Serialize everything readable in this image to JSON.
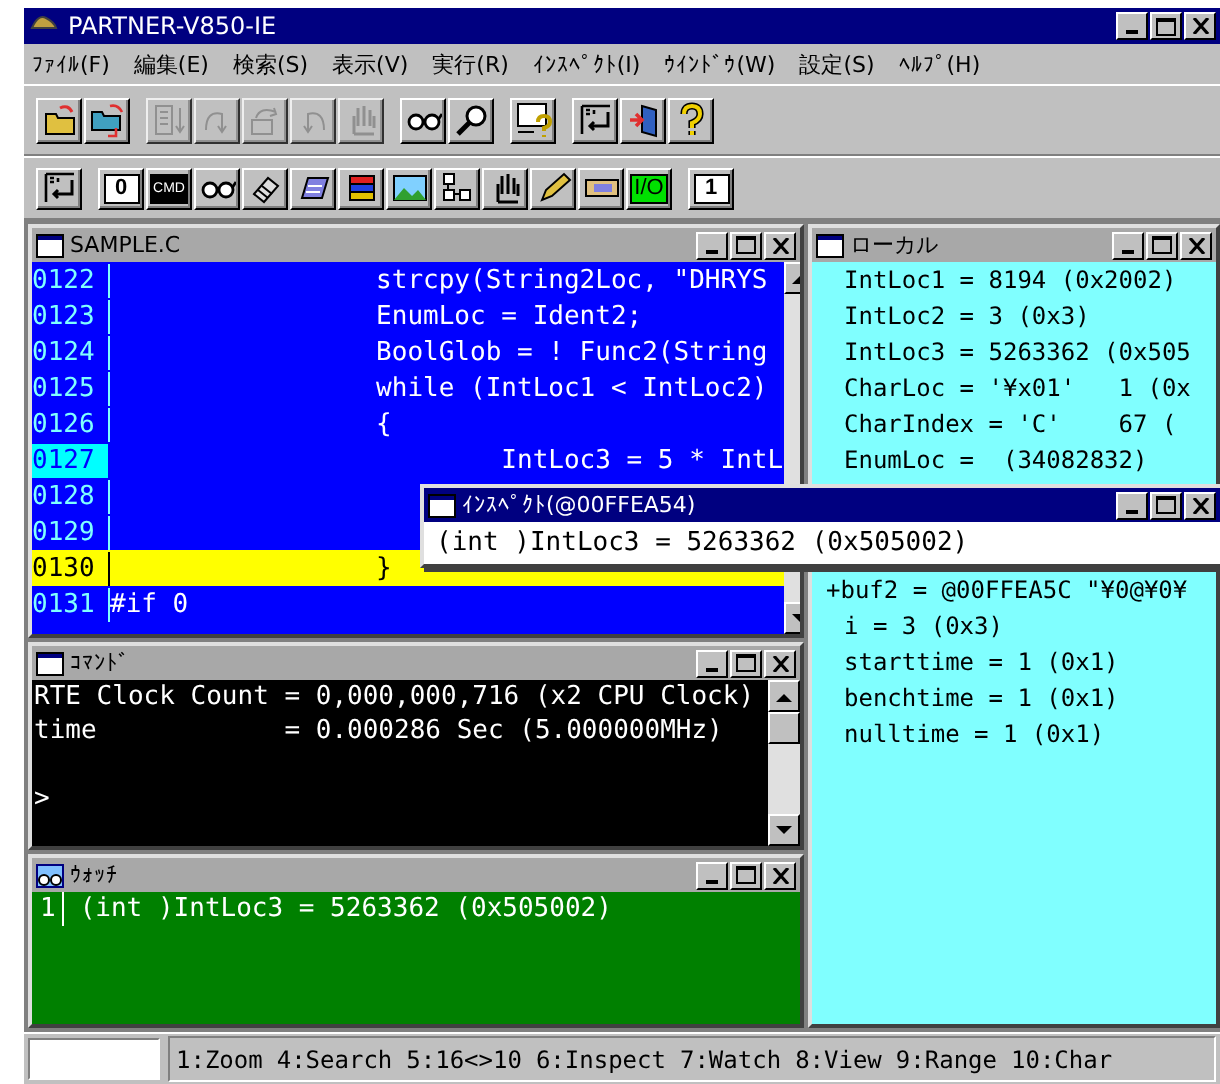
{
  "window": {
    "title": "PARTNER-V850-IE"
  },
  "menu": [
    "ﾌｧｲﾙ(F)",
    "編集(E)",
    "検索(S)",
    "表示(V)",
    "実行(R)",
    "ｲﾝｽﾍﾟｸﾄ(I)",
    "ｳｲﾝﾄﾞｳ(W)",
    "設定(S)",
    "ﾍﾙﾌﾟ(H)"
  ],
  "toolbar_1": [
    [
      {
        "kind": "open-folder",
        "disabled": false
      },
      {
        "kind": "folder-reload",
        "disabled": false
      }
    ],
    [
      {
        "kind": "step-list",
        "disabled": true
      },
      {
        "kind": "step-in",
        "disabled": true
      },
      {
        "kind": "step-over",
        "disabled": true
      },
      {
        "kind": "step-back",
        "disabled": true
      },
      {
        "kind": "hand",
        "disabled": true
      }
    ],
    [
      {
        "kind": "glasses",
        "disabled": false
      },
      {
        "kind": "magnifier",
        "disabled": false
      }
    ],
    [
      {
        "kind": "computer-help",
        "disabled": false
      }
    ],
    [
      {
        "kind": "frame-return",
        "disabled": false
      },
      {
        "kind": "exit-door",
        "disabled": false
      },
      {
        "kind": "help",
        "disabled": false
      }
    ]
  ],
  "toolbar_2": [
    [
      {
        "kind": "frame-return",
        "disabled": false
      }
    ],
    [
      {
        "kind": "label-white",
        "label": "0",
        "disabled": false
      },
      {
        "kind": "label-black",
        "label": "CMD",
        "disabled": false
      },
      {
        "kind": "glasses",
        "disabled": false
      },
      {
        "kind": "eraser",
        "disabled": false
      },
      {
        "kind": "card",
        "disabled": false
      },
      {
        "kind": "books",
        "disabled": false
      },
      {
        "kind": "landscape",
        "disabled": false
      },
      {
        "kind": "nodes",
        "disabled": false
      },
      {
        "kind": "hand",
        "disabled": false
      },
      {
        "kind": "pencil",
        "disabled": false
      },
      {
        "kind": "tape",
        "disabled": false
      },
      {
        "kind": "label-green",
        "label": "I/O",
        "disabled": false
      }
    ],
    [
      {
        "kind": "label-white",
        "label": "1",
        "disabled": false
      }
    ]
  ],
  "source": {
    "title": "SAMPLE.C",
    "active": false,
    "lines": [
      {
        "number": "0122",
        "code": "                 strcpy(String2Loc, \"DHRYS",
        "cursor": false,
        "pc": false
      },
      {
        "number": "0123",
        "code": "                 EnumLoc = Ident2;",
        "cursor": false,
        "pc": false
      },
      {
        "number": "0124",
        "code": "                 BoolGlob = ! Func2(String",
        "cursor": false,
        "pc": false
      },
      {
        "number": "0125",
        "code": "                 while (IntLoc1 < IntLoc2)",
        "cursor": false,
        "pc": false
      },
      {
        "number": "0126",
        "code": "                 {",
        "cursor": false,
        "pc": false
      },
      {
        "number": "0127",
        "code": "                         IntLoc3 = 5 * IntL",
        "cursor": true,
        "pc": false
      },
      {
        "number": "0128",
        "cursor": false,
        "pc": false
      },
      {
        "number": "0129",
        "cursor": false,
        "pc": false
      },
      {
        "number": "0130",
        "code": "                 }",
        "cursor": false,
        "pc": true
      },
      {
        "number": "0131",
        "code": "#if 0",
        "cursor": false,
        "pc": false
      }
    ]
  },
  "command": {
    "title": "ｺﾏﾝﾄﾞ",
    "active": false,
    "lines": [
      {
        "text": "RTE Clock Count = 0,000,000,716 (x2 CPU Clock)"
      },
      {
        "text": "time            = 0.000286 Sec (5.000000MHz)"
      },
      {
        "text": ">",
        "blank_before": true
      }
    ]
  },
  "watch": {
    "title": "ｳｫｯﾁ",
    "active": false,
    "rows": [
      {
        "index": "1",
        "expression": "(int )IntLoc3 = 5263362 (0x505002)"
      }
    ]
  },
  "local": {
    "title": "ローカル",
    "active": false,
    "rows": [
      {
        "kind": "scalar",
        "text": "IntLoc1 = 8194 (0x2002)"
      },
      {
        "kind": "scalar",
        "text": "IntLoc2 = 3 (0x3)"
      },
      {
        "kind": "scalar",
        "text": "IntLoc3 = 5263362 (0x505"
      },
      {
        "kind": "scalar",
        "text": "CharLoc = '¥x01'   1 (0x"
      },
      {
        "kind": "scalar",
        "text": "CharIndex = 'C'    67 ("
      },
      {
        "kind": "scalar",
        "text": "EnumLoc =  (34082832)"
      },
      {
        "kind": "struct",
        "text": "+buf2 = @00FFEA5C \"¥0@¥0¥"
      },
      {
        "kind": "scalar",
        "text": "i = 3 (0x3)"
      },
      {
        "kind": "scalar",
        "text": "starttime = 1 (0x1)"
      },
      {
        "kind": "scalar",
        "text": "benchtime = 1 (0x1)"
      },
      {
        "kind": "scalar",
        "text": "nulltime = 1 (0x1)"
      }
    ]
  },
  "inspect": {
    "title": "ｲﾝｽﾍﾟｸﾄ(@00FFEA54)",
    "active": true,
    "value": "(int )IntLoc3 = 5263362 (0x505002)"
  },
  "status_bar": {
    "keys": [
      "1:Zoom",
      "4:Search",
      "5:16<>10",
      "6:Inspect",
      "7:Watch",
      "8:View",
      "9:Range",
      "10:Char"
    ]
  }
}
